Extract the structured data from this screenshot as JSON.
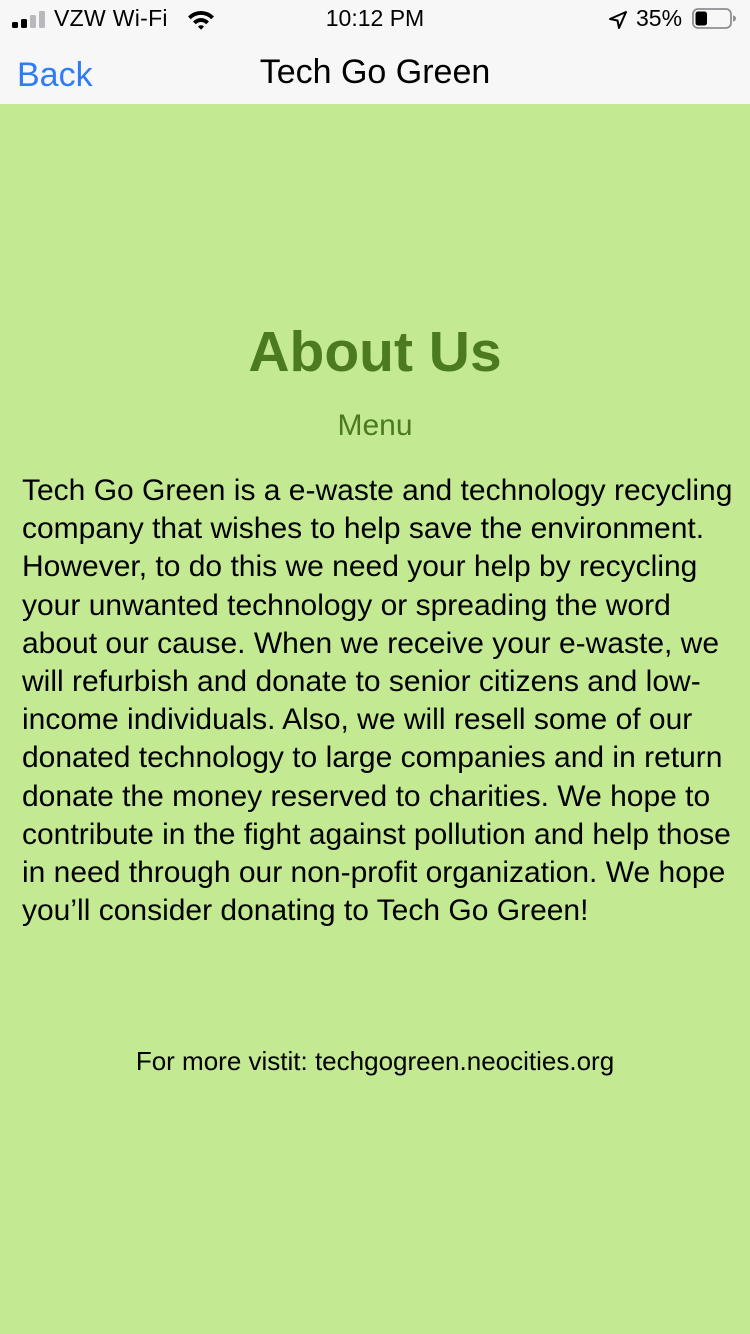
{
  "status_bar": {
    "carrier": "VZW Wi-Fi",
    "time": "10:12 PM",
    "battery_percent": "35%",
    "battery_level": 0.35,
    "signal_bars_active": 2,
    "signal_bars_total": 4,
    "icons": [
      "cellular-signal-icon",
      "wifi-icon",
      "location-arrow-icon",
      "battery-icon"
    ]
  },
  "nav": {
    "back_label": "Back",
    "title": "Tech Go Green"
  },
  "content": {
    "title": "About Us",
    "menu_label": "Menu",
    "body": "Tech Go Green is a e-waste and technology recycling company that wishes to help save the environment. However, to do this we need your help by recycling your unwanted technology or spreading the word about our cause. When we receive your e-waste, we will refurbish and donate to senior citizens and low-income individuals. Also, we will resell some of our donated technology to large companies and in return donate the money reserved to charities. We hope to contribute in the fight against pollution and help those in need through our non-profit organization. We hope you’ll consider donating to Tech Go Green!",
    "footer_text": "For more vistit: techgogreen.neocities.org"
  },
  "colors": {
    "background": "#c3e992",
    "heading_green": "#4c7a1f",
    "link_blue": "#2f7cf6",
    "bar_background": "#f7f7f8"
  }
}
